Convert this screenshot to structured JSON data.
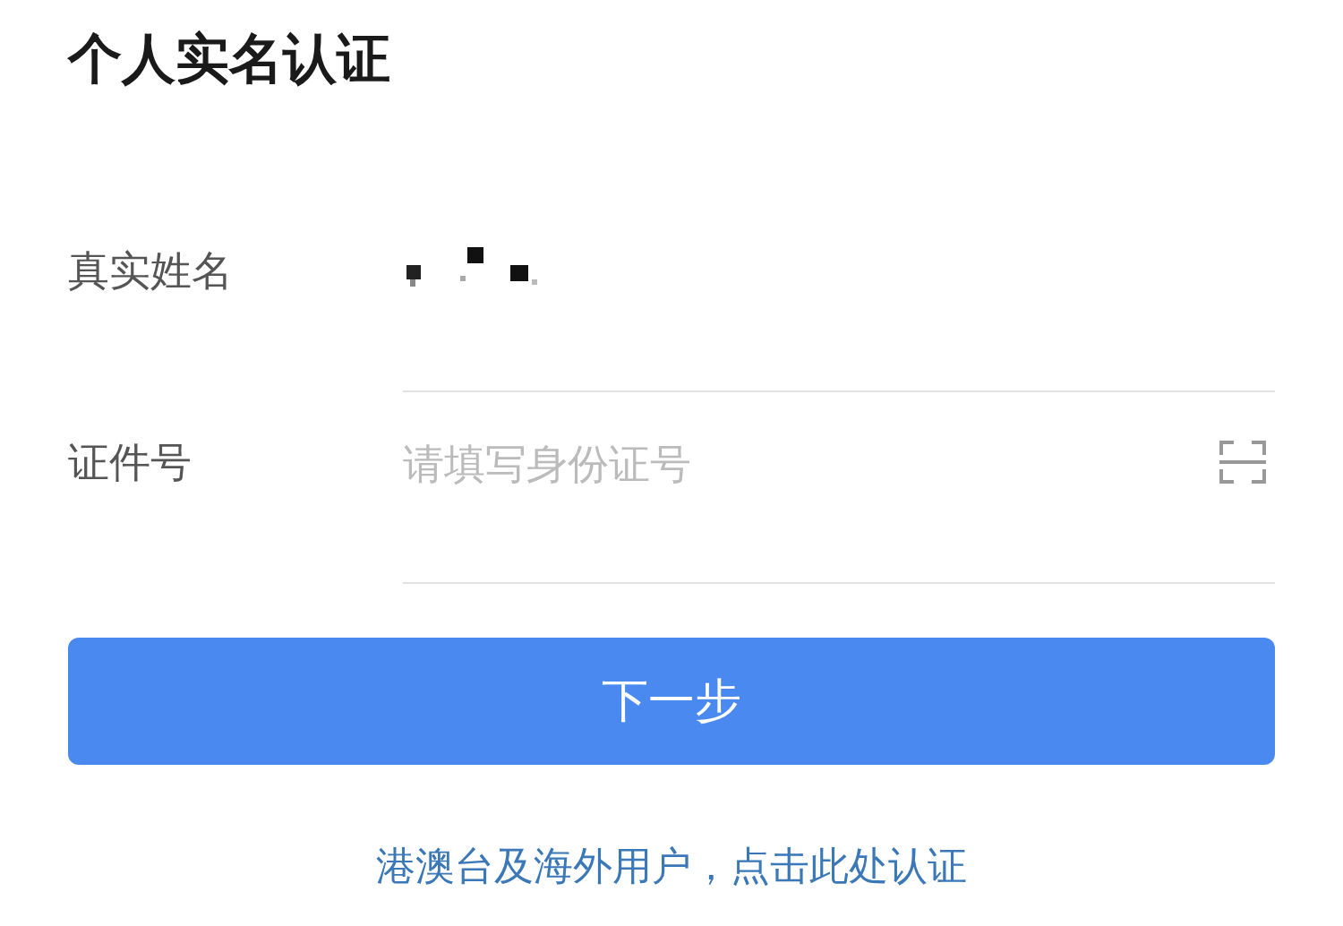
{
  "title": "个人实名认证",
  "fields": [
    {
      "label": "真实姓名",
      "kind": "masked"
    },
    {
      "label": "证件号",
      "kind": "input",
      "placeholder": "请填写身份证号"
    }
  ],
  "button": "下一步",
  "link": "港澳台及海外用户，点击此处认证"
}
